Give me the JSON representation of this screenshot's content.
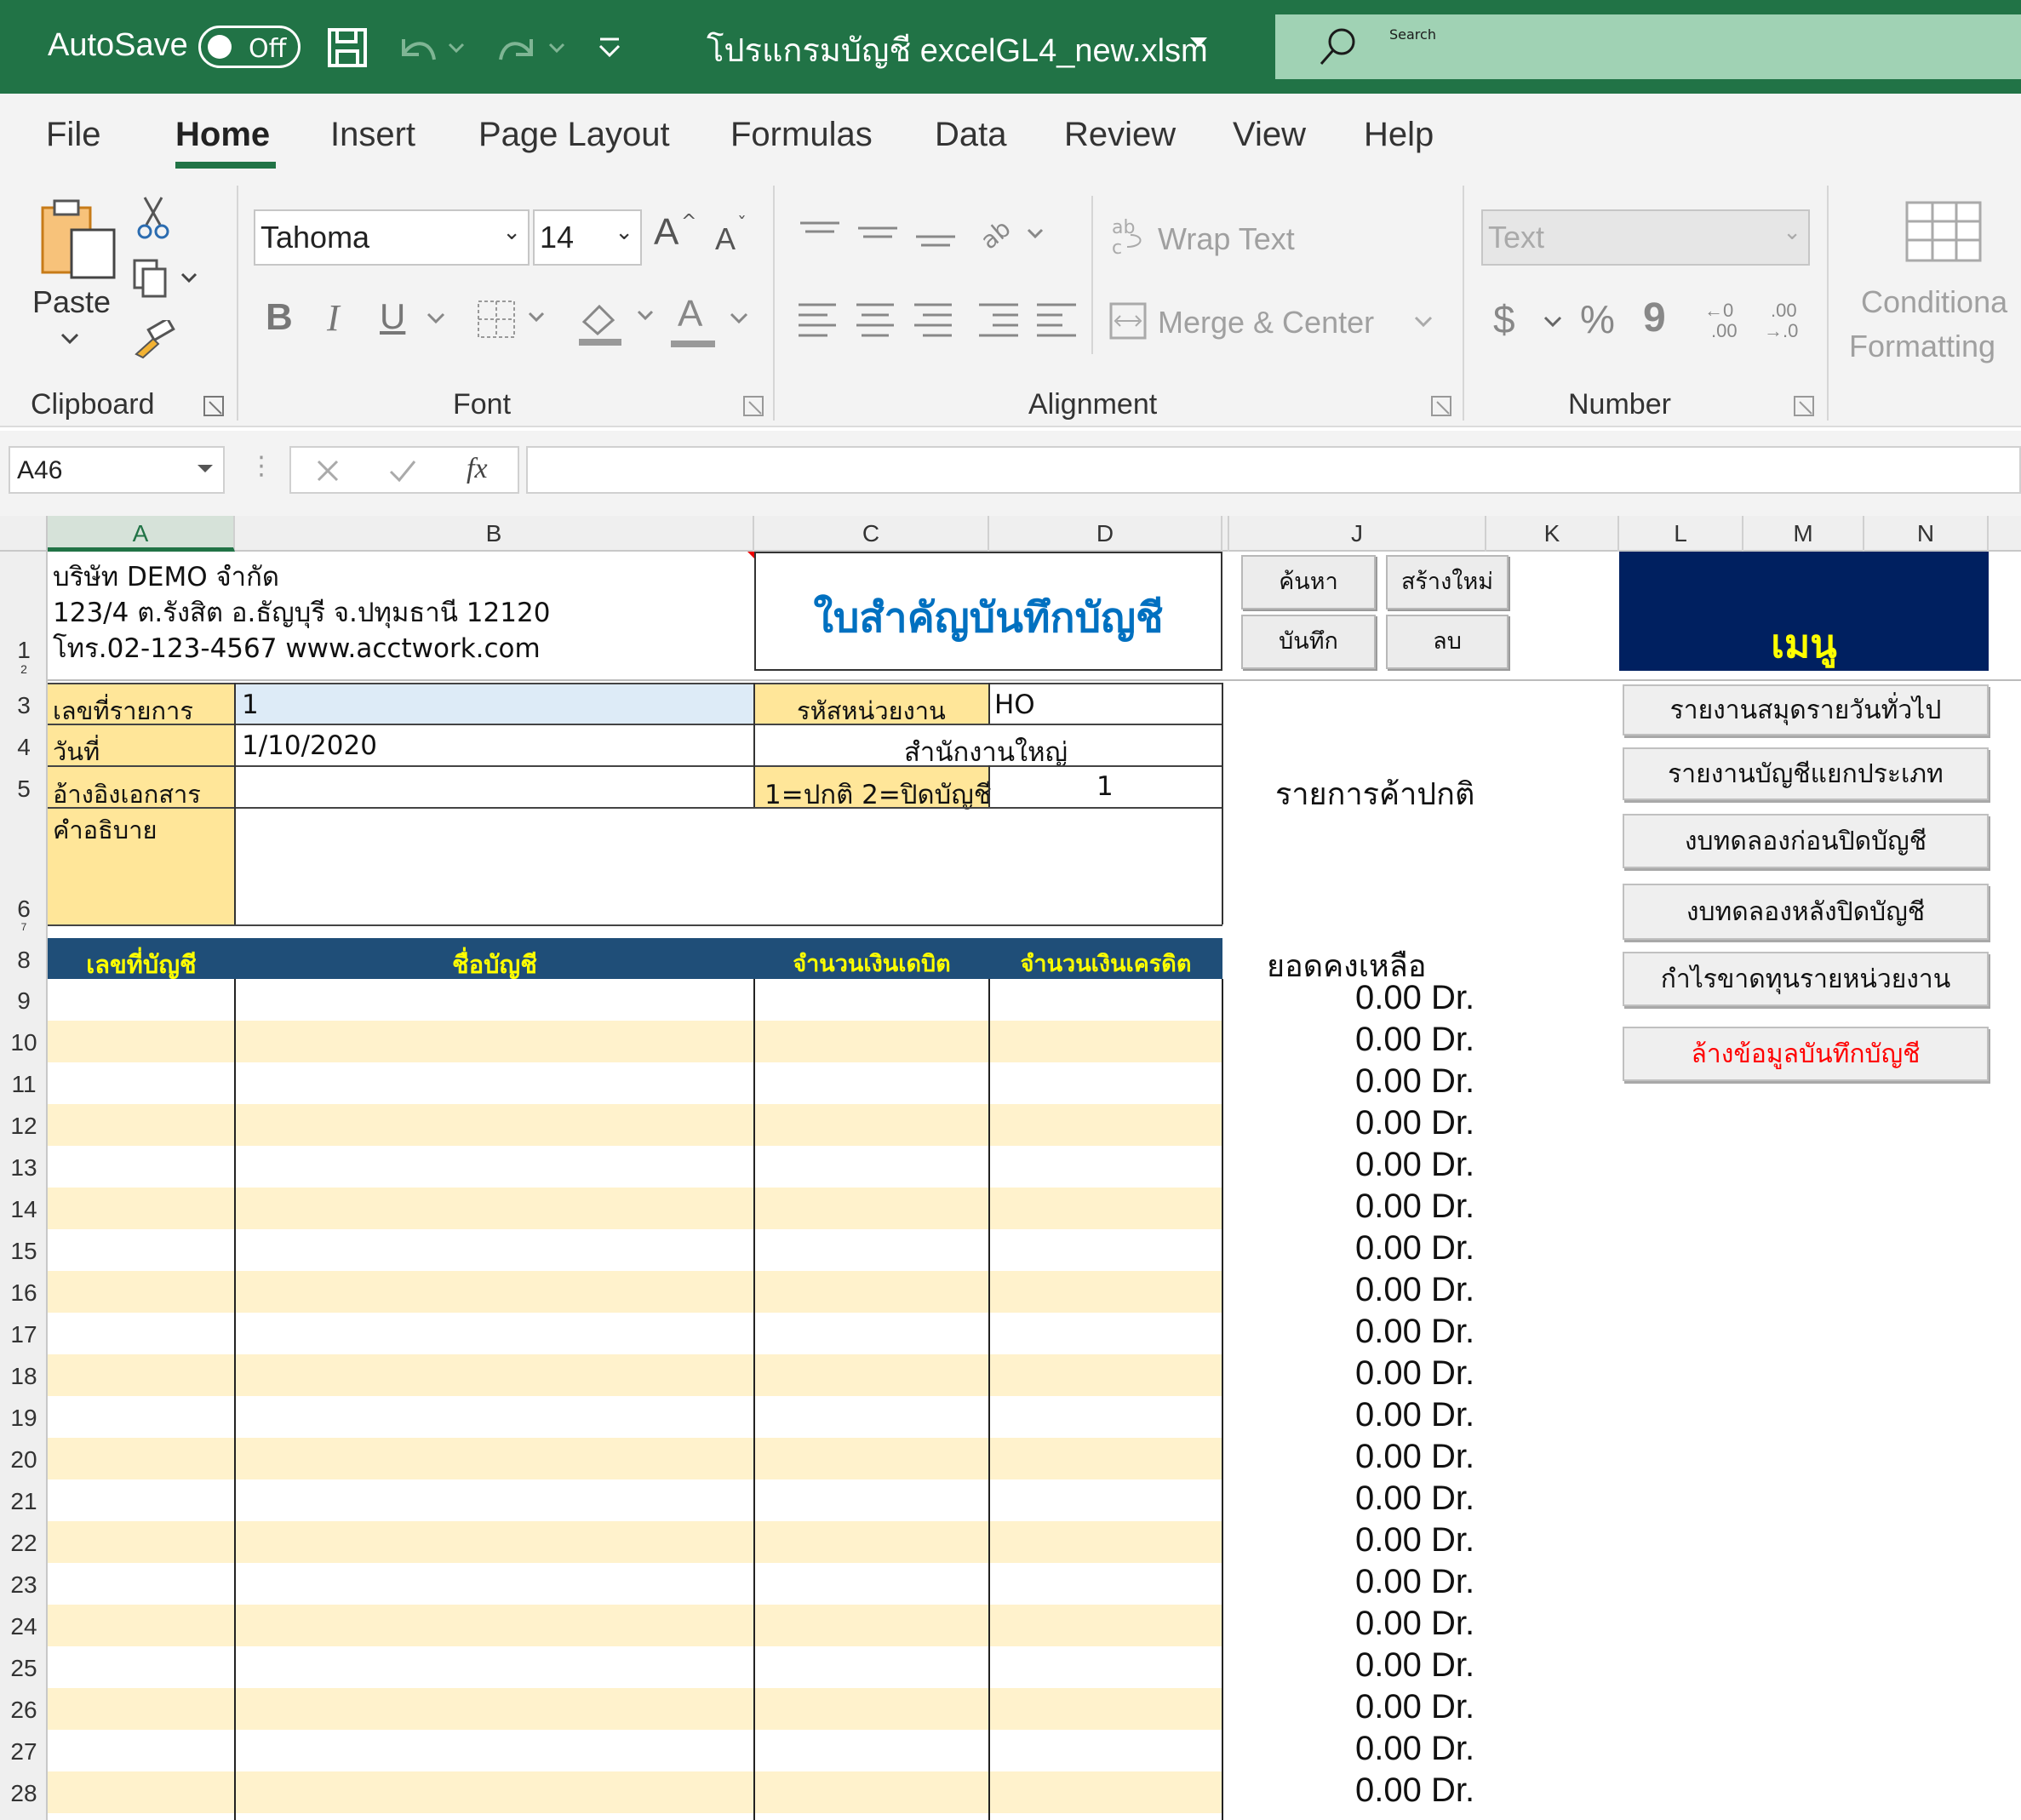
{
  "titlebar": {
    "autosave_label": "AutoSave",
    "autosave_state": "Off",
    "filename": "โปรแกรมบัญชี excelGL4_new.xlsm",
    "search_placeholder": "Search"
  },
  "tabs": [
    "File",
    "Home",
    "Insert",
    "Page Layout",
    "Formulas",
    "Data",
    "Review",
    "View",
    "Help"
  ],
  "active_tab": "Home",
  "ribbon": {
    "clipboard": {
      "paste_label": "Paste",
      "group_label": "Clipboard"
    },
    "font": {
      "font_name": "Tahoma",
      "font_size": "14",
      "group_label": "Font",
      "bold": "B",
      "italic": "I",
      "underline": "U",
      "grow": "A",
      "shrink": "A",
      "font_color": "A"
    },
    "alignment": {
      "wrap_text": "Wrap Text",
      "merge_center": "Merge & Center",
      "group_label": "Alignment"
    },
    "number": {
      "format": "Text",
      "group_label": "Number",
      "currency": "$",
      "percent": "%",
      "comma": "9",
      "inc_decimal_top": "←0",
      "inc_decimal_bottom": ".00",
      "dec_decimal_top": ".00",
      "dec_decimal_bottom": "→.0"
    },
    "styles": {
      "conditional_line1": "Conditiona",
      "conditional_line2": "Formatting"
    }
  },
  "formula_bar": {
    "name_box": "A46",
    "fx": "fx",
    "formula": ""
  },
  "columns": [
    "A",
    "B",
    "C",
    "D",
    "J",
    "K",
    "L",
    "M",
    "N"
  ],
  "rows": [
    "1",
    "2",
    "3",
    "4",
    "5",
    "6",
    "7",
    "8",
    "9",
    "10",
    "11",
    "12",
    "13",
    "14",
    "15",
    "16",
    "17",
    "18",
    "19",
    "20",
    "21",
    "22",
    "23",
    "24",
    "25",
    "26",
    "27",
    "28"
  ],
  "company": {
    "line1": "บริษัท DEMO จำกัด",
    "line2": "123/4 ต.รังสิต อ.ธัญบุรี จ.ปทุมธานี 12120",
    "line3": "โทร.02-123-4567 www.acctwork.com"
  },
  "voucher_title": "ใบสำคัญบันทึกบัญชี",
  "action_buttons": {
    "search": "ค้นหา",
    "create": "สร้างใหม่",
    "save": "บันทึก",
    "delete": "ลบ"
  },
  "menu_header": "เมนู",
  "form": {
    "doc_no_label": "เลขที่รายการ",
    "doc_no_value": "1",
    "date_label": "วันที่",
    "date_value": "1/10/2020",
    "ref_label": "อ้างอิงเอกสาร",
    "ref_value": "",
    "desc_label": "คำอธิบาย",
    "desc_value": "",
    "unit_code_label": "รหัสหน่วยงาน",
    "unit_code_value": "HO",
    "unit_name_value": "สำนักงานใหญ่",
    "type_label": "1=ปกติ 2=ปิดบัญชี",
    "type_value": "1"
  },
  "status_text": "รายการค้าปกติ",
  "table_headers": {
    "account_no": "เลขที่บัญชี",
    "account_name": "ชื่อบัญชี",
    "debit": "จำนวนเงินเดบิต",
    "credit": "จำนวนเงินเครดิต"
  },
  "balance_label": "ยอดคงเหลือ",
  "balances": [
    "0.00 Dr.",
    "0.00 Dr.",
    "0.00 Dr.",
    "0.00 Dr.",
    "0.00 Dr.",
    "0.00 Dr.",
    "0.00 Dr.",
    "0.00 Dr.",
    "0.00 Dr.",
    "0.00 Dr.",
    "0.00 Dr.",
    "0.00 Dr.",
    "0.00 Dr.",
    "0.00 Dr.",
    "0.00 Dr.",
    "0.00 Dr.",
    "0.00 Dr.",
    "0.00 Dr.",
    "0.00 Dr.",
    "0.00 Dr."
  ],
  "menu_items": [
    "รายงานสมุดรายวันทั่วไป",
    "รายงานบัญชีแยกประเภท",
    "งบทดลองก่อนปิดบัญชี",
    "งบทดลองหลังปิดบัญชี",
    "กำไรขาดทุนรายหน่วยงาน",
    "ล้างข้อมูลบันทึกบัญชี"
  ],
  "colors": {
    "excel_green": "#217346",
    "header_navy": "#1f4e78",
    "menu_navy": "#002060",
    "menu_gold": "#ffff00",
    "title_blue": "#0070c0",
    "label_yellow": "#ffe699",
    "band_yellow": "#fff2cc",
    "danger_red": "#ff0000",
    "input_blue": "#ddebf7"
  }
}
